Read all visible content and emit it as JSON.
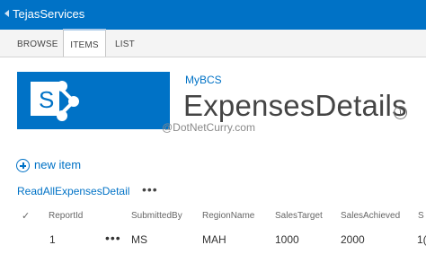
{
  "top_bar": {
    "site_title": "TejasServices"
  },
  "ribbon": {
    "tabs": [
      {
        "label": "BROWSE"
      },
      {
        "label": "ITEMS"
      },
      {
        "label": "LIST"
      }
    ],
    "active_tab": "ITEMS"
  },
  "header": {
    "breadcrumb": "MyBCS",
    "title": "ExpensesDetails",
    "info_icon": "i"
  },
  "watermark": "@DotNetCurry.com",
  "new_item_label": "new item",
  "view": {
    "name": "ReadAllExpensesDetail",
    "more": "•••"
  },
  "table": {
    "check_symbol": "✓",
    "headers": [
      "ReportId",
      "SubmittedBy",
      "RegionName",
      "SalesTarget",
      "SalesAchieved",
      "S"
    ],
    "rows": [
      {
        "ReportId": "1",
        "more": "•••",
        "SubmittedBy": "MS",
        "RegionName": "MAH",
        "SalesTarget": "1000",
        "SalesAchieved": "2000",
        "S": "1("
      }
    ]
  },
  "colors": {
    "brand_blue": "#0072c6",
    "ribbon_bg": "#f4f4f4"
  },
  "icons": {
    "back": "chevron-left-icon",
    "logo": "sharepoint-logo-icon",
    "info": "info-icon",
    "add": "plus-circle-icon",
    "check": "check-icon"
  }
}
